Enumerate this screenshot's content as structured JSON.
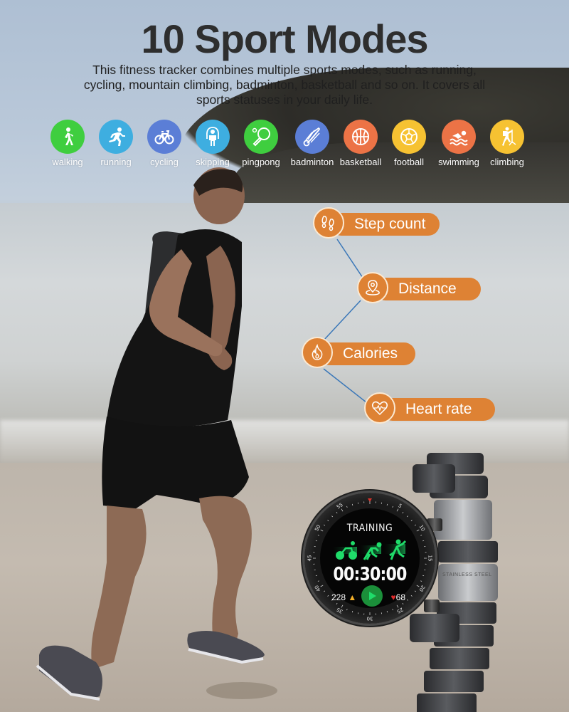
{
  "header": {
    "title": "10 Sport Modes",
    "subtitle": "This fitness tracker combines multiple sports modes, such as running, cycling, mountain climbing, badminton, basketball and so on. It covers all sports statuses in your daily life."
  },
  "sport_modes": [
    {
      "label": "walking",
      "icon": "walking-icon",
      "color": "#3fce3f"
    },
    {
      "label": "running",
      "icon": "running-icon",
      "color": "#3eaee0"
    },
    {
      "label": "cycling",
      "icon": "cycling-icon",
      "color": "#5b7ed6"
    },
    {
      "label": "skipping",
      "icon": "skipping-icon",
      "color": "#3eaee0"
    },
    {
      "label": "pingpong",
      "icon": "pingpong-icon",
      "color": "#3fce3f"
    },
    {
      "label": "badminton",
      "icon": "badminton-icon",
      "color": "#5b7ed6"
    },
    {
      "label": "basketball",
      "icon": "basketball-icon",
      "color": "#ec7346"
    },
    {
      "label": "football",
      "icon": "football-icon",
      "color": "#f6c232"
    },
    {
      "label": "swimming",
      "icon": "swimming-icon",
      "color": "#ec7346"
    },
    {
      "label": "climbing",
      "icon": "climbing-icon",
      "color": "#f6c232"
    }
  ],
  "features": [
    {
      "label": "Step count",
      "icon": "footprints-icon"
    },
    {
      "label": "Distance",
      "icon": "location-pin-icon"
    },
    {
      "label": "Calories",
      "icon": "flame-icon"
    },
    {
      "label": "Heart rate",
      "icon": "heart-pulse-icon"
    }
  ],
  "colors": {
    "feature_accent": "#de8234",
    "connector": "#3a77b8",
    "watch_green": "#1fdc6a"
  },
  "watch": {
    "screen_title": "TRAINING",
    "timer": "00:30:00",
    "calories": "228",
    "heart_rate": "68",
    "band_label": "STAINLESS STEEL",
    "bezel_numbers": [
      "55",
      "5",
      "10",
      "15",
      "20",
      "25",
      "30",
      "35",
      "40",
      "45",
      "50"
    ]
  }
}
